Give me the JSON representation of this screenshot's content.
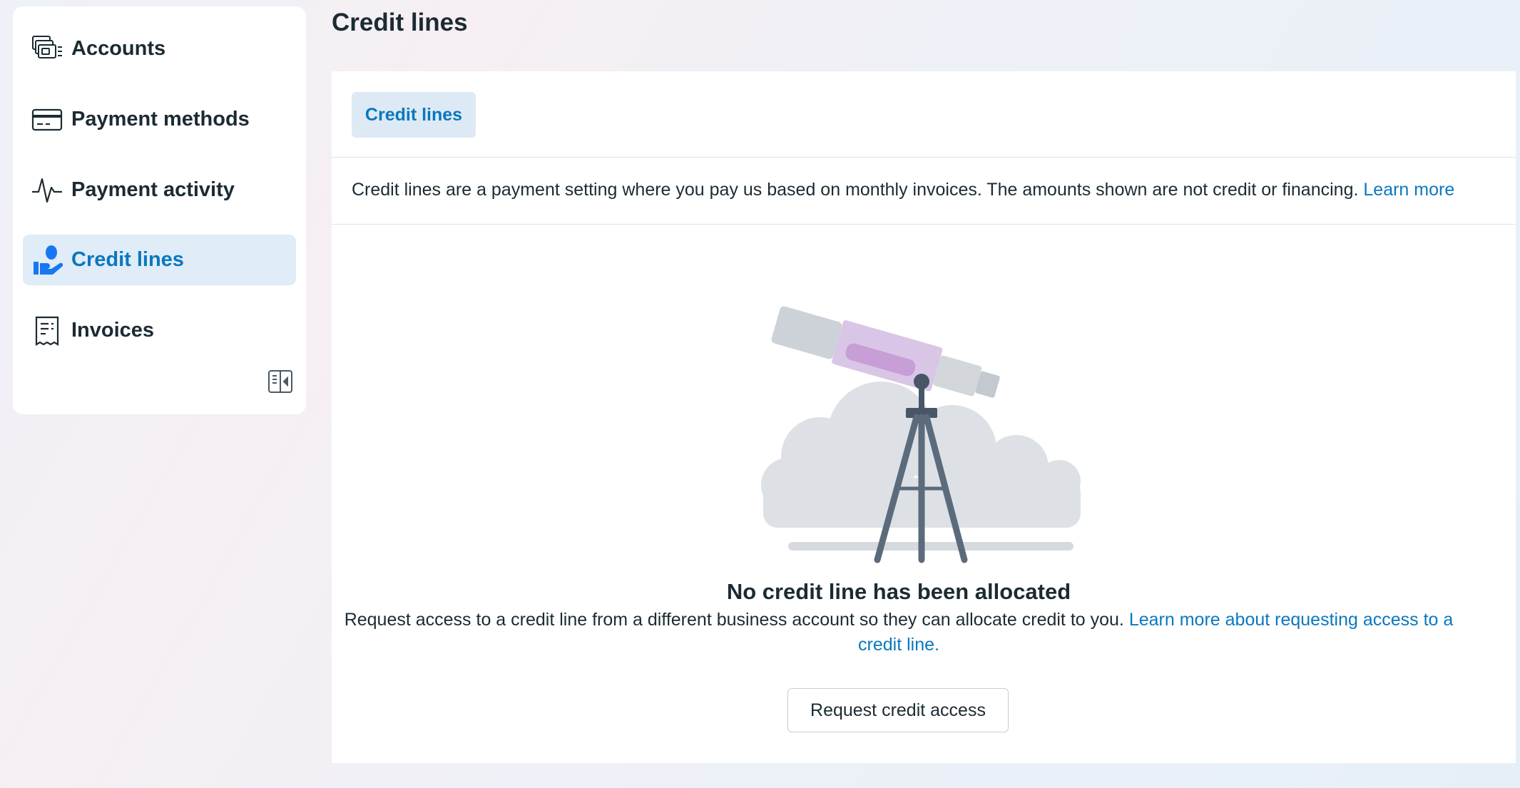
{
  "sidebar": {
    "items": [
      {
        "label": "Accounts",
        "icon": "accounts-icon"
      },
      {
        "label": "Payment methods",
        "icon": "card-icon"
      },
      {
        "label": "Payment activity",
        "icon": "activity-pulse-icon"
      },
      {
        "label": "Credit lines",
        "icon": "hand-coin-icon",
        "active": true
      },
      {
        "label": "Invoices",
        "icon": "receipt-icon"
      }
    ],
    "collapse_icon": "collapse-sidebar-icon"
  },
  "page": {
    "title": "Credit lines"
  },
  "tabs": [
    {
      "label": "Credit lines",
      "active": true
    }
  ],
  "info": {
    "text": "Credit lines are a payment setting where you pay us based on monthly invoices. The amounts shown are not credit or financing.",
    "link": "Learn more"
  },
  "empty_state": {
    "title": "No credit line has been allocated",
    "description": "Request access to a credit line from a different business account so they can allocate credit to you.",
    "link": "Learn more about requesting access to a credit line.",
    "button": "Request credit access",
    "illustration": "telescope-illustration"
  },
  "colors": {
    "accent": "#0a78be",
    "active_bg": "#e0ecf7",
    "text": "#1c2b33"
  }
}
